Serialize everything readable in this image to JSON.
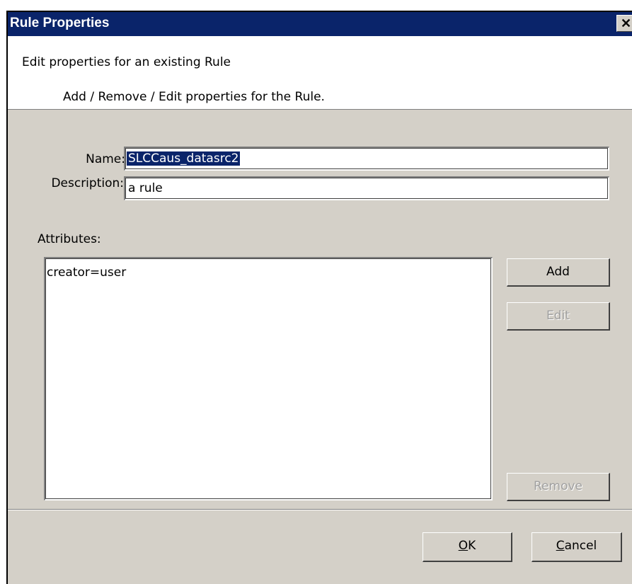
{
  "window": {
    "title": "Rule Properties",
    "close_glyph": "✕"
  },
  "header": {
    "title": "Edit properties for an existing Rule",
    "subtitle": "Add / Remove / Edit properties for the Rule."
  },
  "form": {
    "name_label": "Name:",
    "name_value": "SLCCaus_datasrc2",
    "description_label": "Description:",
    "description_value": "a rule",
    "attributes_label": "Attributes:"
  },
  "attributes": {
    "items": [
      "creator=user"
    ]
  },
  "buttons": {
    "add": "Add",
    "edit": "Edit",
    "remove": "Remove",
    "ok_mnemonic": "O",
    "ok_rest": "K",
    "cancel_mnemonic": "C",
    "cancel_rest": "ancel"
  },
  "colors": {
    "titlebar": "#0a246a",
    "dialog_face": "#d4d0c8",
    "selection": "#0a246a"
  }
}
